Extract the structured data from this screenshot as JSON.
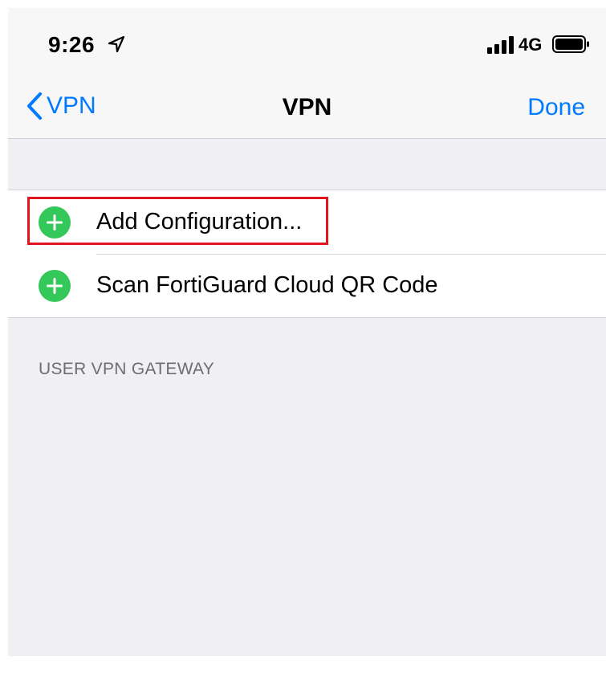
{
  "status_bar": {
    "time": "9:26",
    "network": "4G",
    "icons": [
      "location-arrow-icon",
      "signal-bars-icon",
      "battery-icon"
    ]
  },
  "nav": {
    "back_label": "VPN",
    "title": "VPN",
    "done_label": "Done"
  },
  "list": {
    "items": [
      {
        "label": "Add Configuration...",
        "icon": "add-circle-icon",
        "highlighted": true
      },
      {
        "label": "Scan FortiGuard Cloud QR Code",
        "icon": "add-circle-icon",
        "highlighted": false
      }
    ]
  },
  "section": {
    "header": "USER VPN GATEWAY"
  },
  "colors": {
    "accent": "#007aff",
    "add_icon": "#34c759",
    "highlight": "#e0141e",
    "background": "#efeff4"
  }
}
